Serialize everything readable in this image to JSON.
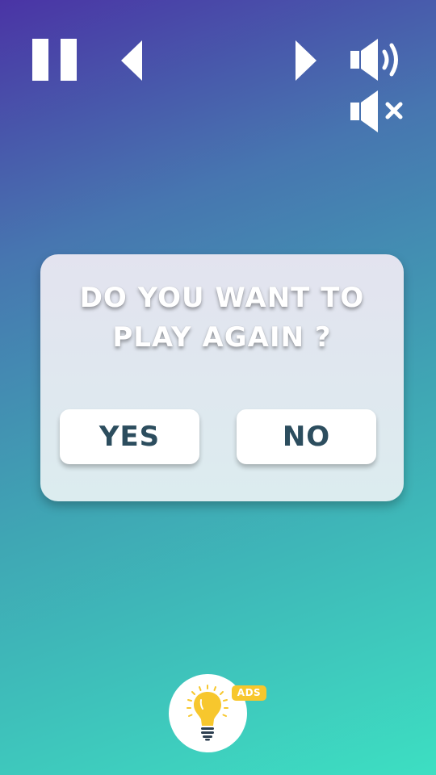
{
  "controls": {
    "pause": "pause-icon",
    "previous": "arrow-left-icon",
    "next": "arrow-right-icon",
    "sound_on": "speaker-on-icon",
    "sound_off": "speaker-mute-icon"
  },
  "dialog": {
    "question_line1": "DO YOU WANT TO",
    "question_line2": "PLAY AGAIN ?",
    "yes_label": "YES",
    "no_label": "NO"
  },
  "hint": {
    "icon": "lightbulb-icon",
    "badge": "ADS"
  },
  "colors": {
    "background_top": "#4a34a5",
    "background_bottom": "#3ddfc2",
    "button_text": "#2c4d5e",
    "badge": "#f7c72d",
    "bulb": "#f7c72d"
  }
}
